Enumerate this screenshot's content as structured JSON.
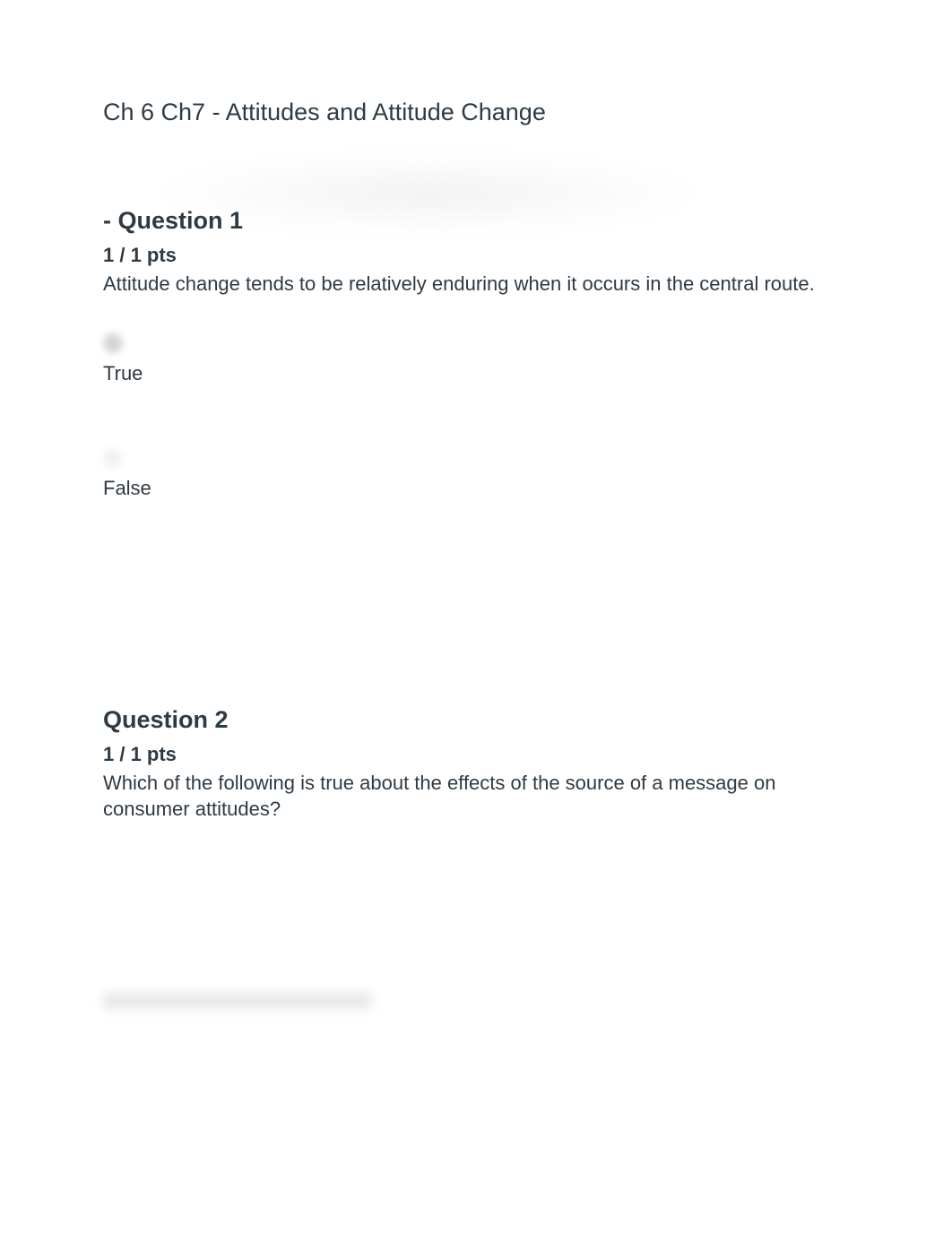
{
  "title": "Ch 6 Ch7 - Attitudes and Attitude Change",
  "questions": [
    {
      "heading": "- Question 1",
      "points": "1 / 1 pts",
      "text": "Attitude change tends to be relatively enduring when it occurs in the central route.",
      "answers": [
        {
          "label": "True",
          "selected": true
        },
        {
          "label": "False",
          "selected": false
        }
      ]
    },
    {
      "heading": "Question 2",
      "points": "1 / 1 pts",
      "text": "Which of the following is true about the effects of the source of a message on consumer attitudes?",
      "answers": []
    }
  ]
}
